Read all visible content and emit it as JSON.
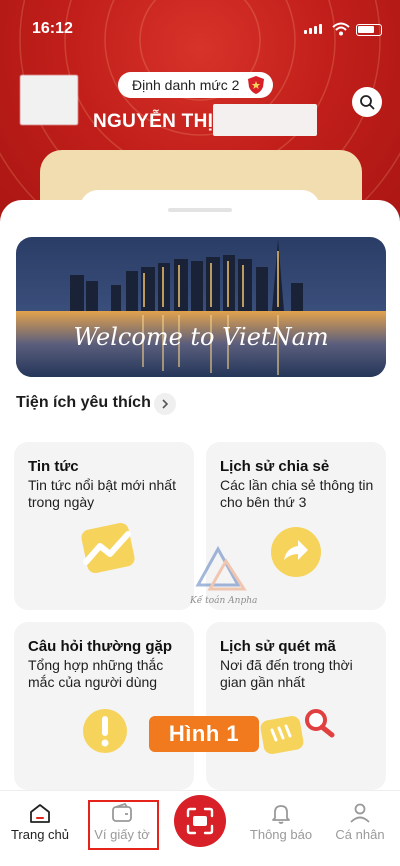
{
  "status_bar": {
    "time": "16:12"
  },
  "header": {
    "level_badge": "Định danh mức 2",
    "user_name": "NGUYỄN THỊ"
  },
  "banner": {
    "caption": "Welcome to VietNam"
  },
  "favorites": {
    "title": "Tiện ích yêu thích",
    "tiles": [
      {
        "title": "Tin tức",
        "description": "Tin tức nổi bật mới nhất trong ngày",
        "icon": "trending-chart-icon"
      },
      {
        "title": "Lịch sử chia sẻ",
        "description": "Các lần chia sẻ thông tin cho bên thứ 3",
        "icon": "share-arrow-icon"
      },
      {
        "title": "Câu hỏi thường gặp",
        "description": "Tổng hợp những thắc mắc của người dùng",
        "icon": "exclamation-icon"
      },
      {
        "title": "Lịch sử quét mã",
        "description": "Nơi đã đến trong thời gian gần nhất",
        "icon": "scan-history-icon"
      }
    ]
  },
  "watermark": {
    "brand": "Kế toán Anpha"
  },
  "callout": {
    "label": "Hình 1"
  },
  "bottom_nav": {
    "items": [
      {
        "label": "Trang chủ",
        "icon": "home-icon",
        "active": true
      },
      {
        "label": "Ví giấy tờ",
        "icon": "wallet-icon",
        "active": false
      },
      {
        "label": "",
        "icon": "scan-icon",
        "active": false
      },
      {
        "label": "Thông báo",
        "icon": "bell-icon",
        "active": false
      },
      {
        "label": "Cá nhân",
        "icon": "person-icon",
        "active": false
      }
    ]
  },
  "colors": {
    "header_red": "#c21f1b",
    "brand_red": "#d72027",
    "callout_orange": "#f07a1d",
    "tile_bg": "#f4f4f4",
    "icon_yellow": "#f6d35a"
  }
}
